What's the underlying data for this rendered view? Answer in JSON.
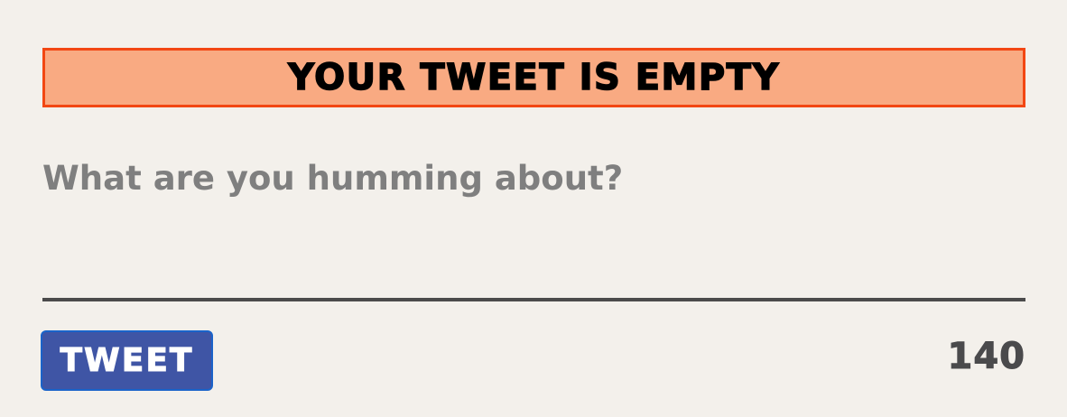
{
  "composer": {
    "error_message": "YOUR TWEET IS EMPTY",
    "input_value": "",
    "input_placeholder": "What are you humming about?",
    "tweet_button_label": "TWEET",
    "char_count": "140"
  },
  "colors": {
    "background": "#f3f0eb",
    "error_fill": "#f9aa82",
    "error_border": "#f24713",
    "button_fill": "#3f55a5",
    "button_border": "#1a63c9",
    "divider": "#4b4b4b",
    "placeholder": "#7f7f7f",
    "counter": "#4a4a4c"
  }
}
